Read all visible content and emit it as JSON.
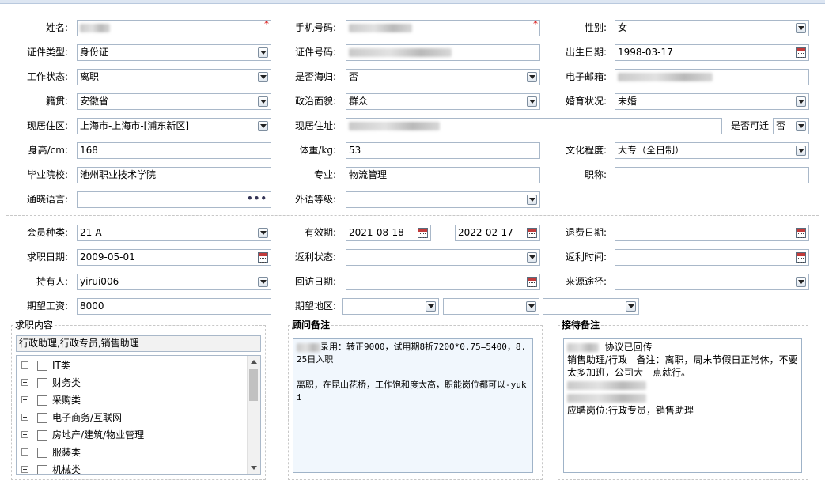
{
  "personal": {
    "name_label": "姓名:",
    "phone_label": "手机号码:",
    "gender_label": "性别:",
    "gender_value": "女",
    "id_type_label": "证件类型:",
    "id_type_value": "身份证",
    "id_number_label": "证件号码:",
    "birth_label": "出生日期:",
    "birth_value": "1998-03-17",
    "work_status_label": "工作状态:",
    "work_status_value": "离职",
    "returnee_label": "是否海归:",
    "returnee_value": "否",
    "email_label": "电子邮箱:",
    "native_label": "籍贯:",
    "native_value": "安徽省",
    "political_label": "政治面貌:",
    "political_value": "群众",
    "marital_label": "婚育状况:",
    "marital_value": "未婚",
    "region_label": "现居住区:",
    "region_value": "上海市-上海市-[浦东新区]",
    "address_label": "现居住址:",
    "relocate_label": "是否可迁",
    "relocate_value": "否",
    "height_label": "身高/cm:",
    "height_value": "168",
    "weight_label": "体重/kg:",
    "weight_value": "53",
    "education_label": "文化程度:",
    "education_value": "大专（全日制）",
    "school_label": "毕业院校:",
    "school_value": "池州职业技术学院",
    "major_label": "专业:",
    "major_value": "物流管理",
    "title_label": "职称:",
    "language_label": "通晓语言:",
    "language_more": "•••",
    "foreign_level_label": "外语等级:"
  },
  "membership": {
    "type_label": "会员种类:",
    "type_value": "21-A",
    "validity_label": "有效期:",
    "validity_start": "2021-08-18",
    "validity_sep": "----",
    "validity_end": "2022-02-17",
    "refund_date_label": "退费日期:",
    "job_date_label": "求职日期:",
    "job_date_value": "2009-05-01",
    "rebate_status_label": "返利状态:",
    "rebate_time_label": "返利时间:",
    "holder_label": "持有人:",
    "holder_value": "yirui006",
    "visit_date_label": "回访日期:",
    "source_label": "来源途径:",
    "salary_label": "期望工资:",
    "salary_value": "8000",
    "region_label": "期望地区:"
  },
  "job": {
    "title": "求职内容",
    "summary": "行政助理,行政专员,销售助理",
    "categories": [
      "IT类",
      "财务类",
      "采购类",
      "电子商务/互联网",
      "房地产/建筑/物业管理",
      "服装类",
      "机械类"
    ]
  },
  "advisor": {
    "title": "顾问备注",
    "line1": "录用：转正9000，试用期8折7200*0.75=5400，8.25日入职",
    "line2": "离职，在昆山花桥，工作饱和度太高，职能岗位都可以-yuki"
  },
  "reception": {
    "title": "接待备注",
    "line1": "协议已回传",
    "line2": "销售助理/行政   备注：离职，周末节假日正常休，不要太多加班，公司大一点就行。",
    "line3": "应聘岗位:行政专员，销售助理"
  }
}
